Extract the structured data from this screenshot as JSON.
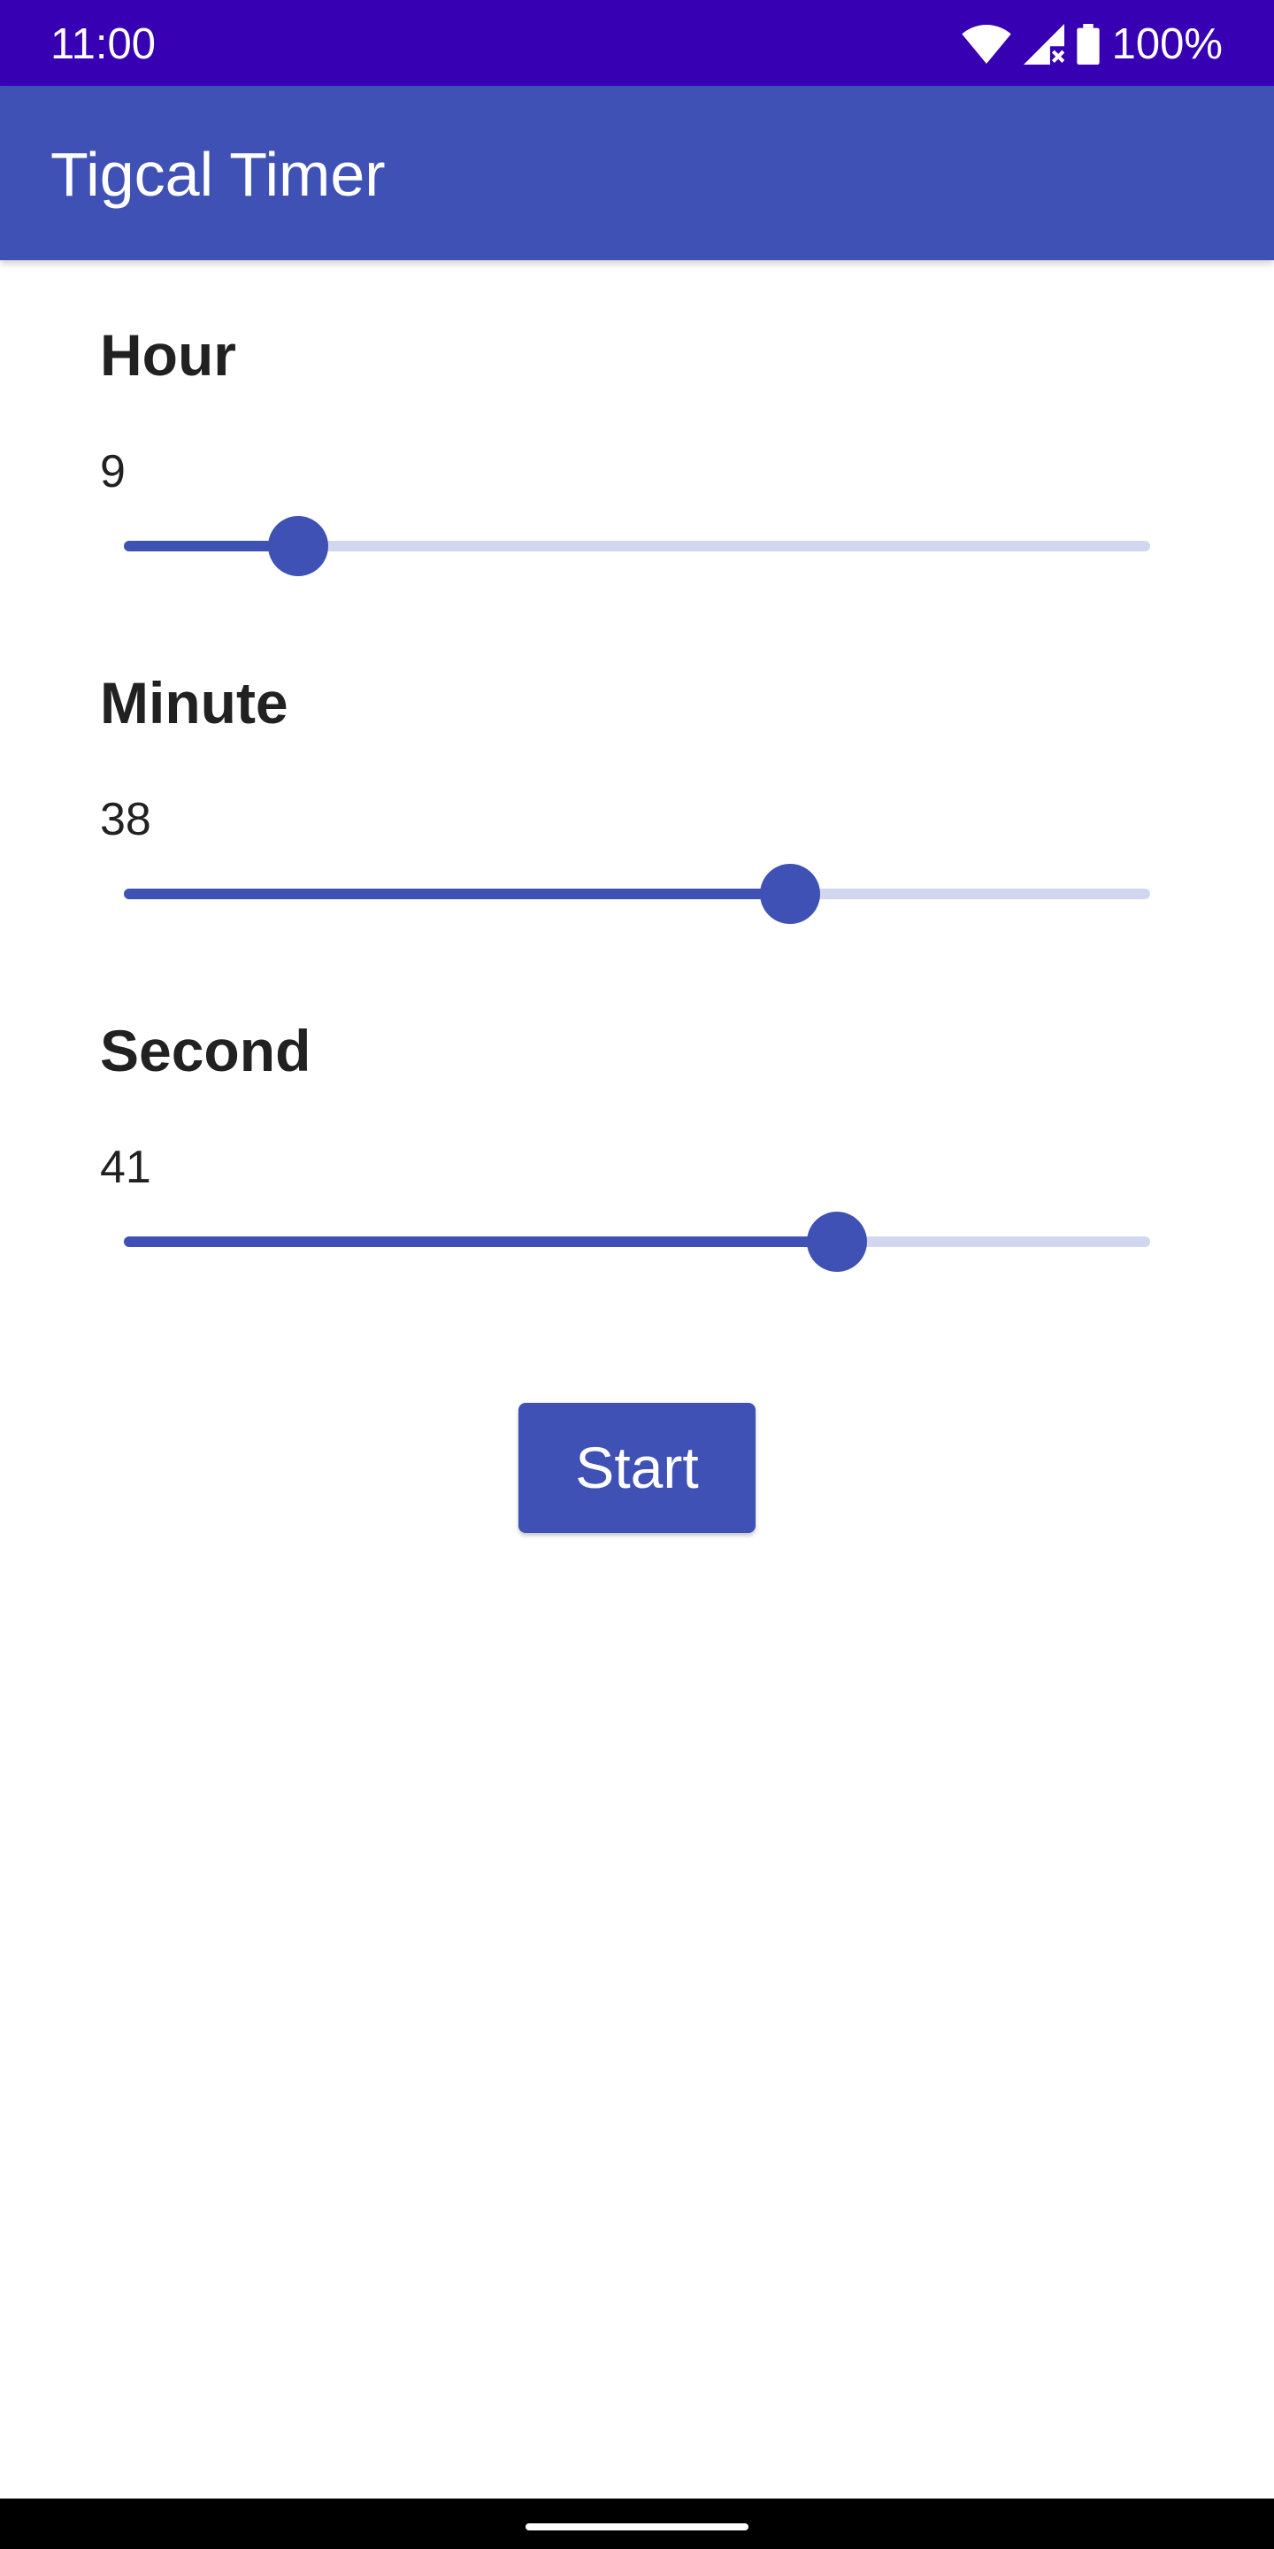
{
  "status_bar": {
    "time": "11:00",
    "battery_percent": "100%",
    "icons": [
      "wifi-icon",
      "signal-no-data-icon",
      "battery-icon"
    ],
    "color": "#3700b3"
  },
  "app_bar": {
    "title": "Tigcal Timer",
    "color": "#3f51b5"
  },
  "sections": [
    {
      "heading": "Hour",
      "value": "9",
      "slider_fraction": 0.17
    },
    {
      "heading": "Minute",
      "value": "38",
      "slider_fraction": 0.649
    },
    {
      "heading": "Second",
      "value": "41",
      "slider_fraction": 0.695
    }
  ],
  "start_button": {
    "label": "Start"
  },
  "colors": {
    "accent": "#3f51b5",
    "track_inactive": "#d1d7ef",
    "text": "#212121"
  }
}
